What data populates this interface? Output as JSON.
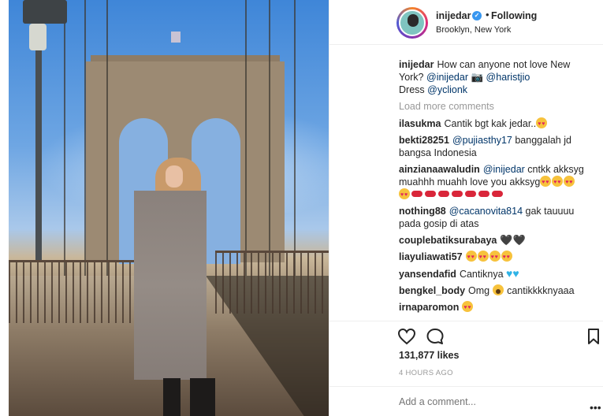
{
  "post": {
    "username": "inijedar",
    "follow_status": "Following",
    "location": "Brooklyn, New York",
    "caption": {
      "username": "inijedar",
      "text_1": "How can anyone not love New York?",
      "mention_1": "@inijedar",
      "camera_emoji": "📷",
      "mention_2": "@haristjio",
      "text_2": "Dress",
      "mention_3": "@yclionk"
    },
    "load_more": "Load more comments",
    "comments": [
      {
        "user": "ilasukma",
        "text": "Cantik bgt kak jedar.."
      },
      {
        "user": "bekti28251",
        "mention": "@pujiasthy17",
        "text": "banggalah jd bangsa Indonesia"
      },
      {
        "user": "ainzianaawaludin",
        "mention": "@inijedar",
        "text": "cntkk akksyg muahhh muahh love you akksyg"
      },
      {
        "user": "nothing88",
        "mention": "@cacanovita814",
        "text": "gak tauuuu pada gosip di atas"
      },
      {
        "user": "couplebatiksurabaya",
        "text": "🖤🖤"
      },
      {
        "user": "liayuliawati57",
        "text": ""
      },
      {
        "user": "yansendafid",
        "text": "Cantiknya"
      },
      {
        "user": "bengkel_body",
        "text_before": "Omg",
        "text": "cantikkkknyaaa"
      },
      {
        "user": "irnaparomon",
        "text": ""
      }
    ],
    "likes": "131,877 likes",
    "timestamp": "4 HOURS AGO",
    "add_comment_placeholder": "Add a comment...",
    "more_glyph": "•••"
  },
  "icons": {
    "verified": "verified-badge-icon",
    "like": "heart-outline-icon",
    "comment": "comment-bubble-icon",
    "save": "bookmark-icon",
    "more": "more-options-icon"
  },
  "colors": {
    "verified": "#3897f0",
    "mention": "#003569",
    "muted": "#999999",
    "border": "#efefef"
  }
}
